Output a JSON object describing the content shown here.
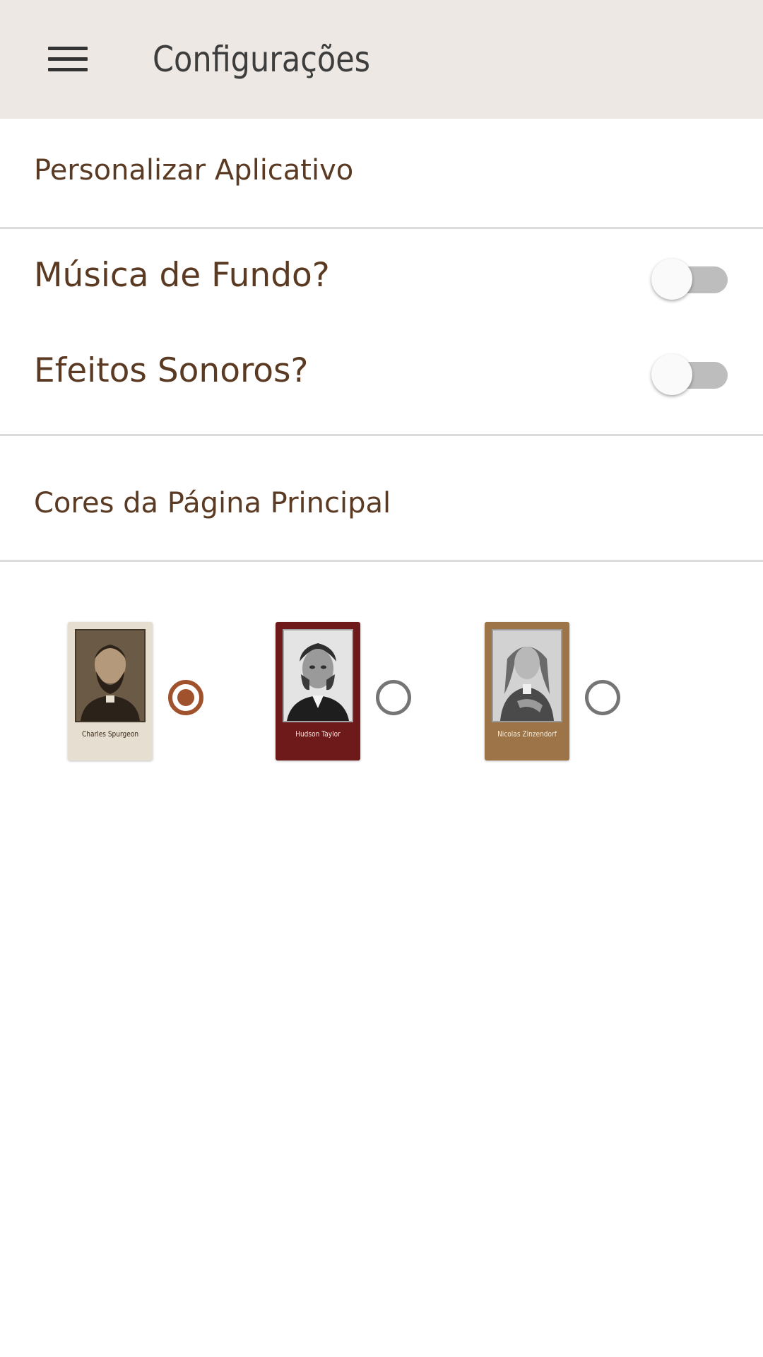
{
  "app_bar": {
    "title": "Configurações",
    "menu_icon": "hamburger-menu-icon",
    "background": "#ede8e4"
  },
  "sections": {
    "personalize": "Personalizar Aplicativo",
    "home_colors": "Cores da Página Principal"
  },
  "settings": [
    {
      "label": "Música de Fundo?",
      "enabled": false
    },
    {
      "label": "Efeitos Sonoros?",
      "enabled": false
    }
  ],
  "themes": [
    {
      "name": "Charles Spurgeon",
      "selected": true,
      "card_color": "#e6ded0",
      "text_color": "#3a2a1a"
    },
    {
      "name": "Hudson Taylor",
      "selected": false,
      "card_color": "#6e1a1a",
      "text_color": "#f0e6e0"
    },
    {
      "name": "Nicolas Zinzendorf",
      "selected": false,
      "card_color": "#9c7448",
      "text_color": "#f3ead8"
    }
  ],
  "colors": {
    "text_brown": "#5a3a22",
    "accent": "#a0522d",
    "radio_off": "#757575",
    "divider": "#dcdcdc"
  }
}
